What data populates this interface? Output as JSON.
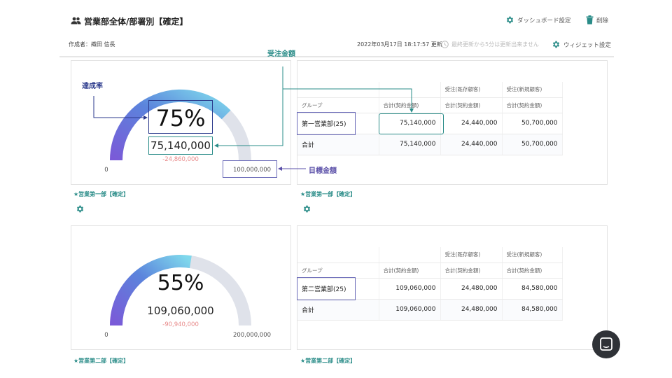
{
  "header": {
    "title": "営業部全体/部署別【確定】",
    "dashboard_settings": "ダッシュボード設定",
    "delete": "削除",
    "author": "作成者：織田 信長",
    "updated": "2022年03月17日 18:17:57 更新",
    "update_note": "最終更新から5分は更新出来ません",
    "widget_settings": "ウィジェット設定"
  },
  "annotations": {
    "achievement": "達成率",
    "order_amount": "受注金額",
    "target_amount": "目標金額"
  },
  "widgets": [
    {
      "gauge": {
        "percent": "75%",
        "amount": "75,140,000",
        "diff": "-24,860,000",
        "min": "0",
        "max": "100,000,000",
        "fill": 0.75
      },
      "gauge_caption": "★営業第一部【確定】",
      "table_caption": "★営業第一部【確定】",
      "table": {
        "top_headers": [
          "",
          "",
          "受注(既存顧客)",
          "受注(新規顧客)"
        ],
        "sub_headers": [
          "グループ",
          "合計(契約金額)",
          "合計(契約金額)",
          "合計(契約金額)"
        ],
        "rows": [
          [
            "第一営業部(25)",
            "75,140,000",
            "24,440,000",
            "50,700,000"
          ],
          [
            "合計",
            "75,140,000",
            "24,440,000",
            "50,700,000"
          ]
        ]
      }
    },
    {
      "gauge": {
        "percent": "55%",
        "amount": "109,060,000",
        "diff": "-90,940,000",
        "min": "0",
        "max": "200,000,000",
        "fill": 0.55
      },
      "gauge_caption": "★営業第二部【確定】",
      "table_caption": "★営業第二部【確定】",
      "table": {
        "top_headers": [
          "",
          "",
          "受注(既存顧客)",
          "受注(新規顧客)"
        ],
        "sub_headers": [
          "グループ",
          "合計(契約金額)",
          "合計(契約金額)",
          "合計(契約金額)"
        ],
        "rows": [
          [
            "第二営業部(25)",
            "109,060,000",
            "24,480,000",
            "84,580,000"
          ],
          [
            "合計",
            "109,060,000",
            "24,480,000",
            "84,580,000"
          ]
        ]
      }
    }
  ],
  "icons": {
    "team": "users-icon",
    "gear": "gear-icon",
    "trash": "trash-icon",
    "clock": "clock-icon",
    "chat": "chat-icon"
  },
  "colors": {
    "gauge_start": "#7a5ad8",
    "gauge_end": "#7fd8ec",
    "gauge_track": "#dfe2ea",
    "caption": "#2a8c88",
    "diff": "#e88a8a",
    "annotation": "#2b3a8c"
  }
}
